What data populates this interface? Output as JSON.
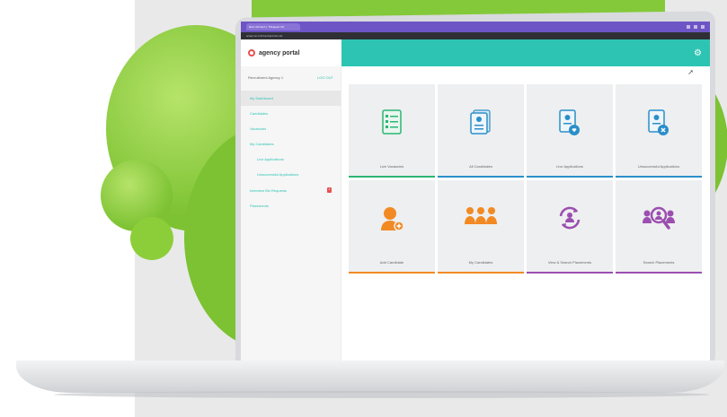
{
  "browser": {
    "tab_label": "Recruitment | Tribepad UK",
    "url": "www.recruitmentportal.net"
  },
  "app": {
    "brand_name": "agency portal",
    "gear_icon": "gear-icon"
  },
  "sidebar": {
    "agency_name": "Recruitment Agency 1",
    "logout_label": "LOG OUT",
    "items": [
      {
        "label": "My Dashboard"
      },
      {
        "label": "Candidates"
      },
      {
        "label": "Vacancies"
      },
      {
        "label": "My Candidates"
      },
      {
        "label": "Live Applications"
      },
      {
        "label": "Unsuccessful Applications"
      },
      {
        "label": "Interview Bin Requests",
        "badge": "3"
      },
      {
        "label": "Placements"
      }
    ]
  },
  "tiles": [
    {
      "label": "Live Vacancies",
      "icon": "checklist-document-icon",
      "color": "#2bb673"
    },
    {
      "label": "All Candidates",
      "icon": "candidate-documents-icon",
      "color": "#2a8fc9"
    },
    {
      "label": "Live Applications",
      "icon": "application-heart-icon",
      "color": "#2a8fc9"
    },
    {
      "label": "Unsuccessful Applications",
      "icon": "application-cross-icon",
      "color": "#2a8fc9"
    },
    {
      "label": "Add Candidate",
      "icon": "add-candidate-icon",
      "color": "#f28a24"
    },
    {
      "label": "My Candidates",
      "icon": "team-icon",
      "color": "#f28a24"
    },
    {
      "label": "View & Search Placements",
      "icon": "refresh-person-icon",
      "color": "#9b4fb0"
    },
    {
      "label": "Search Placements",
      "icon": "search-people-icon",
      "color": "#9b4fb0"
    }
  ],
  "colors": {
    "accent": "#2ec4b3",
    "browser": "#6e55c6",
    "green": "#7cc232"
  }
}
